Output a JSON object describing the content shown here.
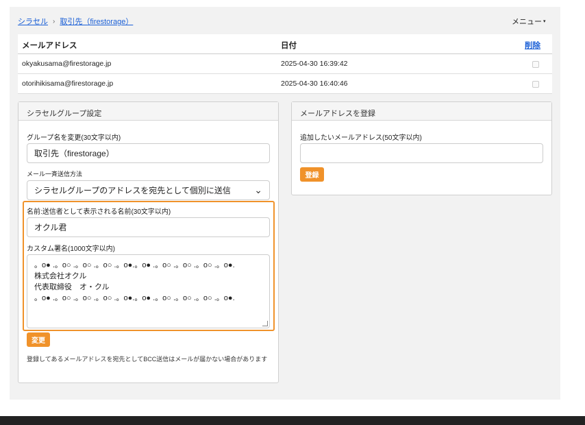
{
  "breadcrumb": {
    "root": "シラセル",
    "separator": "›",
    "current": "取引先（firestorage）"
  },
  "menu": {
    "label": "メニュー",
    "caret": "▾"
  },
  "table": {
    "headers": {
      "email": "メールアドレス",
      "date": "日付",
      "delete": "削除"
    },
    "rows": [
      {
        "email": "okyakusama@firestorage.jp",
        "date": "2025-04-30 16:39:42",
        "checked": false
      },
      {
        "email": "otorihikisama@firestorage.jp",
        "date": "2025-04-30 16:40:46",
        "checked": false
      }
    ]
  },
  "group_settings": {
    "title": "シラセルグループ設定",
    "group_name_label": "グループ名を変更(30文字以内)",
    "group_name_value": "取引先（firestorage）",
    "send_method_label": "メール一斉送信方法",
    "send_method_value": "シラセルグループのアドレスを宛先として個別に送信",
    "sender_name_label": "名前:送信者として表示される名前(30文字以内)",
    "sender_name_value": "オクル君",
    "signature_label": "カスタム署名(1000文字以内)",
    "signature_value": "。o● .。o○ .。o○ .。o○ .。o●.。o● .。o○ .。o○ .。o○ .。o●.\n株式会社オクル\n代表取締役　オ・クル\n。o● .。o○ .。o○ .。o○ .。o●.。o● .。o○ .。o○ .。o○ .。o●.",
    "change_button": "変更",
    "note": "登録してあるメールアドレスを宛先としてBCC送信はメールが届かない場合があります"
  },
  "register_email": {
    "title": "メールアドレスを登録",
    "input_label": "追加したいメールアドレス(50文字以内)",
    "input_value": "",
    "register_button": "登録"
  },
  "colors": {
    "accent": "#f0922a",
    "link": "#1a5fd6",
    "footer": "#222222"
  }
}
